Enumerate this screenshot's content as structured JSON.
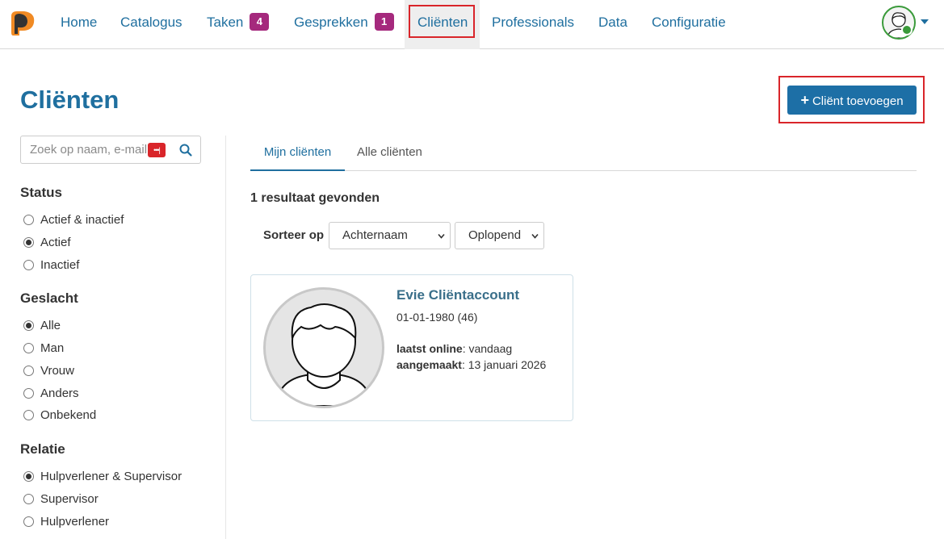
{
  "nav": {
    "items": [
      {
        "label": "Home"
      },
      {
        "label": "Catalogus"
      },
      {
        "label": "Taken",
        "badge": "4"
      },
      {
        "label": "Gesprekken",
        "badge": "1"
      },
      {
        "label": "Cliënten",
        "active": true
      },
      {
        "label": "Professionals"
      },
      {
        "label": "Data"
      },
      {
        "label": "Configuratie"
      }
    ],
    "brand_color": "#1f6f9f",
    "badge_color": "#a5297d"
  },
  "page": {
    "title": "Cliënten",
    "add_button_label": "Cliënt toevoegen"
  },
  "sidebar": {
    "search_placeholder": "Zoek op naam, e-mail",
    "status": {
      "title": "Status",
      "options": [
        {
          "label": "Actief & inactief",
          "checked": false
        },
        {
          "label": "Actief",
          "checked": true
        },
        {
          "label": "Inactief",
          "checked": false
        }
      ]
    },
    "gender": {
      "title": "Geslacht",
      "options": [
        {
          "label": "Alle",
          "checked": true
        },
        {
          "label": "Man",
          "checked": false
        },
        {
          "label": "Vrouw",
          "checked": false
        },
        {
          "label": "Anders",
          "checked": false
        },
        {
          "label": "Onbekend",
          "checked": false
        }
      ]
    },
    "relation": {
      "title": "Relatie",
      "options": [
        {
          "label": "Hulpverlener & Supervisor",
          "checked": true
        },
        {
          "label": "Supervisor",
          "checked": false
        },
        {
          "label": "Hulpverlener",
          "checked": false
        }
      ]
    }
  },
  "main": {
    "tabs": [
      {
        "label": "Mijn cliënten",
        "active": true
      },
      {
        "label": "Alle cliënten",
        "active": false
      }
    ],
    "results_text": "1 resultaat gevonden",
    "sort_label": "Sorteer op",
    "sort_field": "Achternaam",
    "sort_order": "Oplopend",
    "clients": [
      {
        "name": "Evie Cliëntaccount",
        "dob": "01-01-1980 (46)",
        "last_online_label": "laatst online",
        "last_online": ": vandaag",
        "created_label": "aangemaakt",
        "created": ": 13 januari 2026"
      }
    ]
  },
  "icons": {
    "logo": "app-logo-icon",
    "search": "search-icon",
    "password_manager": "password-manager-icon",
    "user_avatar": "user-avatar-icon",
    "dropdown": "caret-down-icon",
    "plus": "plus-icon"
  }
}
